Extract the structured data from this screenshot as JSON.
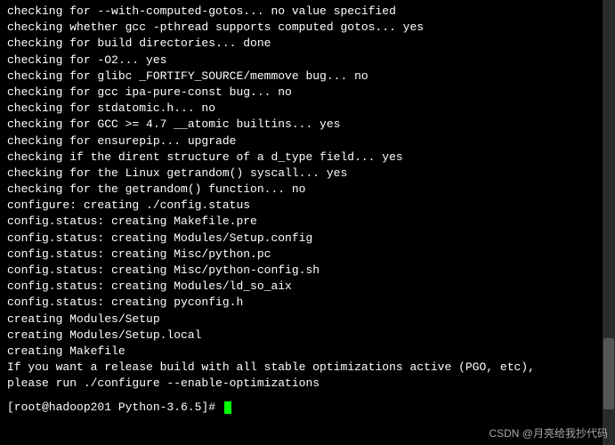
{
  "lines": [
    "checking for --with-computed-gotos... no value specified",
    "checking whether gcc -pthread supports computed gotos... yes",
    "checking for build directories... done",
    "checking for -O2... yes",
    "checking for glibc _FORTIFY_SOURCE/memmove bug... no",
    "checking for gcc ipa-pure-const bug... no",
    "checking for stdatomic.h... no",
    "checking for GCC >= 4.7 __atomic builtins... yes",
    "checking for ensurepip... upgrade",
    "checking if the dirent structure of a d_type field... yes",
    "checking for the Linux getrandom() syscall... yes",
    "checking for the getrandom() function... no",
    "configure: creating ./config.status",
    "config.status: creating Makefile.pre",
    "config.status: creating Modules/Setup.config",
    "config.status: creating Misc/python.pc",
    "config.status: creating Misc/python-config.sh",
    "config.status: creating Modules/ld_so_aix",
    "config.status: creating pyconfig.h",
    "creating Modules/Setup",
    "creating Modules/Setup.local",
    "creating Makefile",
    "",
    "",
    "If you want a release build with all stable optimizations active (PGO, etc),",
    "please run ./configure --enable-optimizations",
    ""
  ],
  "prompt": "[root@hadoop201 Python-3.6.5]# ",
  "watermark": "CSDN @月亮给我抄代码"
}
